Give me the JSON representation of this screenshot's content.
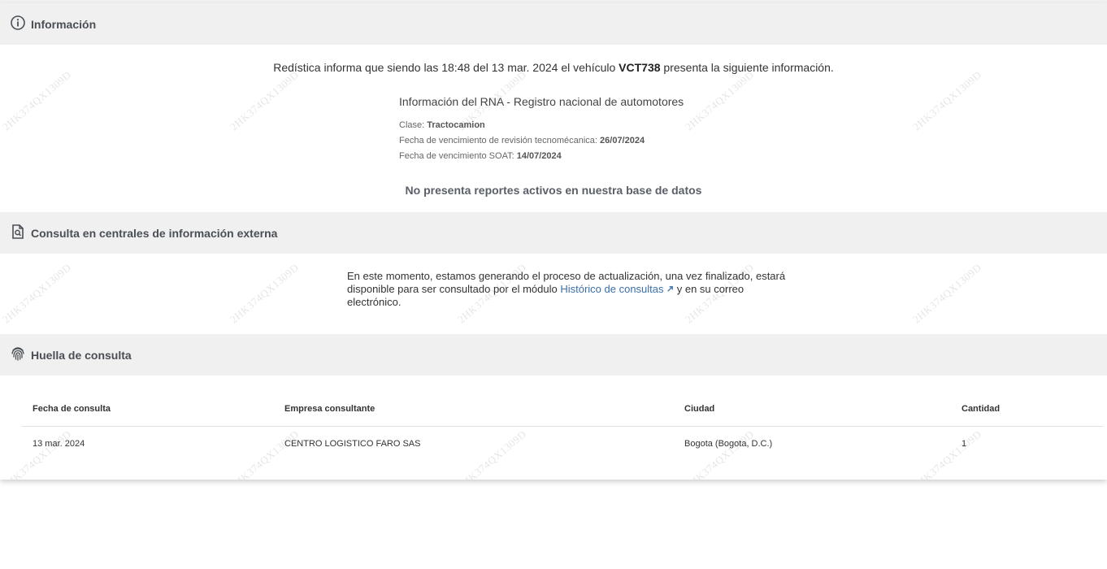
{
  "sections": {
    "info": {
      "title": "Información",
      "icon": "info-circle-icon"
    },
    "external": {
      "title": "Consulta en centrales de información externa",
      "icon": "document-search-icon"
    },
    "fingerprint": {
      "title": "Huella de consulta",
      "icon": "fingerprint-icon"
    }
  },
  "info": {
    "intro_pre": "Redística informa que siendo las 18:48 del 13 mar. 2024 el vehículo ",
    "plate": "VCT738",
    "intro_post": " presenta la siguiente información.",
    "rna_title": "Información del RNA - Registro nacional de automotores",
    "clase_label": "Clase: ",
    "clase_value": "Tractocamion",
    "rtm_label": "Fecha de vencimiento de revisión tecnomécanica: ",
    "rtm_value": "26/07/2024",
    "soat_label": "Fecha de vencimiento SOAT: ",
    "soat_value": "14/07/2024",
    "no_reports": "No presenta reportes activos en nuestra base de datos"
  },
  "external": {
    "msg_pre": "En este momento, estamos generando el proceso de actualización, una vez finalizado, estará disponible para ser consultado por el módulo ",
    "link_label": "Histórico de consultas",
    "link_icon": "external-link-icon",
    "msg_post": " y en su correo electrónico."
  },
  "table": {
    "headers": [
      "Fecha de consulta",
      "Empresa consultante",
      "Ciudad",
      "Cantidad"
    ],
    "rows": [
      [
        "13 mar. 2024",
        "CENTRO LOGISTICO FARO SAS",
        "Bogota (Bogota, D.C.)",
        "1"
      ]
    ]
  },
  "watermark_text": "2HK374QX1309D"
}
